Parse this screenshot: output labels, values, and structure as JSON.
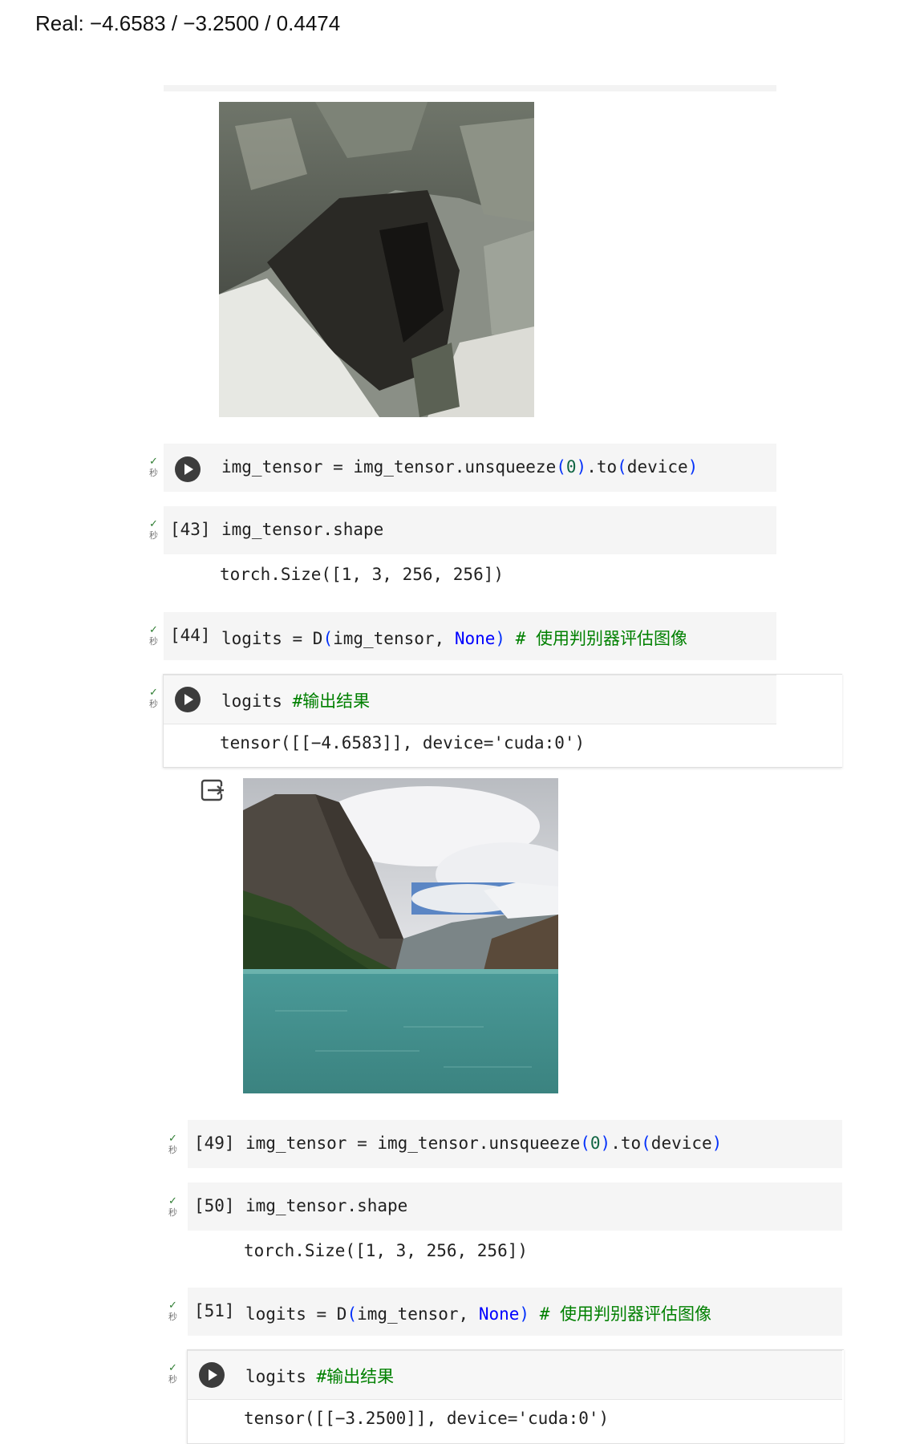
{
  "header": {
    "real_text": "Real: −4.6583 / −3.2500 / 0.4474"
  },
  "gutter": {
    "check": "✓",
    "sec": "秒"
  },
  "cells_top": [
    {
      "exec": "",
      "code": [
        "img_tensor = img_tensor.unsqueeze",
        "(",
        "0",
        ")",
        ".to",
        "(",
        "device",
        ")"
      ]
    },
    {
      "exec": "[43]",
      "code": [
        "img_tensor.shape"
      ],
      "output": "torch.Size([1, 3, 256, 256])"
    },
    {
      "exec": "[44]",
      "code": [
        "logits = D",
        "(",
        "img_tensor, ",
        "None",
        ")",
        " # 使用判别器评估图像"
      ]
    },
    {
      "exec": "",
      "code": [
        "logits ",
        "#输出结果"
      ],
      "output": "tensor([[−4.6583]], device='cuda:0')"
    }
  ],
  "cells_bottom": [
    {
      "exec": "[49]",
      "code": [
        "img_tensor = img_tensor.unsqueeze",
        "(",
        "0",
        ")",
        ".to",
        "(",
        "device",
        ")"
      ]
    },
    {
      "exec": "[50]",
      "code": [
        "img_tensor.shape"
      ],
      "output": "torch.Size([1, 3, 256, 256])"
    },
    {
      "exec": "[51]",
      "code": [
        "logits = D",
        "(",
        "img_tensor, ",
        "None",
        ")",
        " # 使用判别器评估图像"
      ]
    },
    {
      "exec": "",
      "code": [
        "logits ",
        "#输出结果"
      ],
      "output": "tensor([[−3.2500]], device='cuda:0')"
    }
  ],
  "images": {
    "rock_cave": "rock-cave-photo",
    "mountain_lake": "mountain-lake-photo"
  },
  "icons": {
    "output_toggle": "output-toggle-icon",
    "run": "play-icon"
  }
}
